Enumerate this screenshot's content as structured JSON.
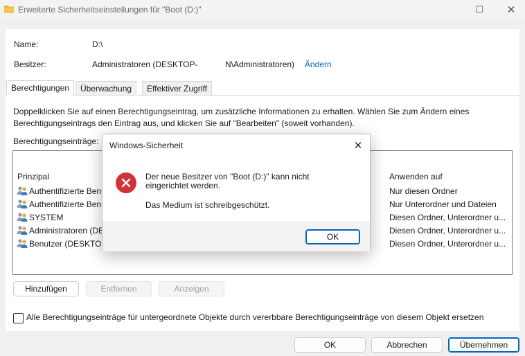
{
  "window": {
    "title": "Erweiterte Sicherheitseinstellungen für \"Boot (D:)\"",
    "maximize": "☐",
    "close": "✕"
  },
  "header": {
    "name_label": "Name:",
    "name_value": "D:\\",
    "owner_label": "Besitzer:",
    "owner_value_a": "Administratoren (DESKTOP-",
    "owner_value_b": "N\\Administratoren)",
    "change_link": "Ändern"
  },
  "tabs": [
    "Berechtigungen",
    "Überwachung",
    "Effektiver Zugriff"
  ],
  "permissions": {
    "description_line1": "Doppelklicken Sie auf einen Berechtigungseintrag, um zusätzliche Informationen zu erhalten. Wählen Sie zum Ändern eines",
    "description_line2": "Berechtigungseintrags den Eintrag aus, und klicken Sie auf \"Bearbeiten\" (soweit vorhanden).",
    "entries_label": "Berechtigungseinträge:",
    "col_principal": "Prinzipal",
    "col_apply": "Anwenden auf",
    "rows": [
      {
        "principal": "Authentifizierte Benu",
        "apply": "Nur diesen Ordner"
      },
      {
        "principal": "Authentifizierte Benu",
        "apply": "Nur Unterordner und Dateien"
      },
      {
        "principal": "SYSTEM",
        "apply": "Diesen Ordner, Unterordner u..."
      },
      {
        "principal": "Administratoren (DES",
        "apply": "Diesen Ordner, Unterordner u..."
      },
      {
        "principal": "Benutzer (DESKTOP-",
        "apply": "Diesen Ordner, Unterordner u..."
      }
    ],
    "add_button": "Hinzufügen",
    "remove_button": "Entfernen",
    "view_button": "Anzeigen",
    "replace_checkbox_label": "Alle Berechtigungseinträge für untergeordnete Objekte durch vererbbare Berechtigungseinträge von diesem Objekt ersetzen"
  },
  "footer": {
    "ok": "OK",
    "cancel": "Abbrechen",
    "apply": "Übernehmen"
  },
  "dialog": {
    "title": "Windows-Sicherheit",
    "message": "Der neue Besitzer von \"Boot (D:)\" kann nicht eingerichtet werden.",
    "detail": "Das Medium ist schreibgeschützt.",
    "ok": "OK",
    "close": "✕"
  },
  "colors": {
    "accent": "#0067c0",
    "error": "#d13438"
  }
}
